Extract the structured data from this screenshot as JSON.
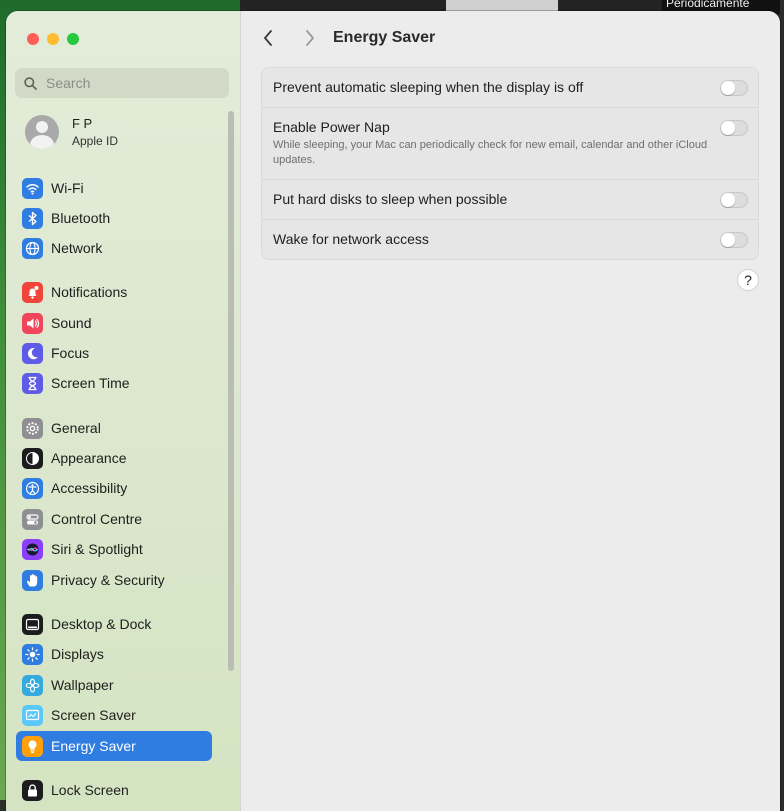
{
  "backdrop": {
    "partial_text": "Periodicamente"
  },
  "sidebar": {
    "search_placeholder": "Search",
    "account": {
      "name": "F P",
      "subtitle": "Apple ID"
    },
    "items": [
      {
        "label": "Wi-Fi",
        "icon": "wifi-icon",
        "color": "#2f7de1"
      },
      {
        "label": "Bluetooth",
        "icon": "bluetooth-icon",
        "color": "#2f7de1"
      },
      {
        "label": "Network",
        "icon": "globe-icon",
        "color": "#2f7de1"
      },
      {
        "label": "Notifications",
        "icon": "bell-icon",
        "color": "#f0453a"
      },
      {
        "label": "Sound",
        "icon": "speaker-icon",
        "color": "#f0455a"
      },
      {
        "label": "Focus",
        "icon": "moon-icon",
        "color": "#5e5ce6"
      },
      {
        "label": "Screen Time",
        "icon": "hourglass-icon",
        "color": "#5e5ce6"
      },
      {
        "label": "General",
        "icon": "gear-icon",
        "color": "#8e8e93"
      },
      {
        "label": "Appearance",
        "icon": "appearance-icon",
        "color": "#1c1c1e"
      },
      {
        "label": "Accessibility",
        "icon": "accessibility-icon",
        "color": "#2f7de1"
      },
      {
        "label": "Control Centre",
        "icon": "toggles-icon",
        "color": "#8e8e93"
      },
      {
        "label": "Siri & Spotlight",
        "icon": "siri-icon",
        "color": "#8a3ffc"
      },
      {
        "label": "Privacy & Security",
        "icon": "hand-icon",
        "color": "#2f7de1"
      },
      {
        "label": "Desktop & Dock",
        "icon": "dock-icon",
        "color": "#1c1c1e"
      },
      {
        "label": "Displays",
        "icon": "sun-icon",
        "color": "#2f7de1"
      },
      {
        "label": "Wallpaper",
        "icon": "flower-icon",
        "color": "#35aadc"
      },
      {
        "label": "Screen Saver",
        "icon": "screensaver-icon",
        "color": "#5ac8fa"
      },
      {
        "label": "Energy Saver",
        "icon": "bulb-icon",
        "color": "#ff9f0a",
        "selected": true
      },
      {
        "label": "Lock Screen",
        "icon": "lock-icon",
        "color": "#1c1c1e"
      }
    ]
  },
  "main": {
    "title": "Energy Saver",
    "settings": [
      {
        "title": "Prevent automatic sleeping when the display is off",
        "description": "",
        "enabled": false
      },
      {
        "title": "Enable Power Nap",
        "description": "While sleeping, your Mac can periodically check for new email, calendar and other iCloud updates.",
        "enabled": false
      },
      {
        "title": "Put hard disks to sleep when possible",
        "description": "",
        "enabled": false
      },
      {
        "title": "Wake for network access",
        "description": "",
        "enabled": false
      }
    ],
    "help_label": "?"
  }
}
